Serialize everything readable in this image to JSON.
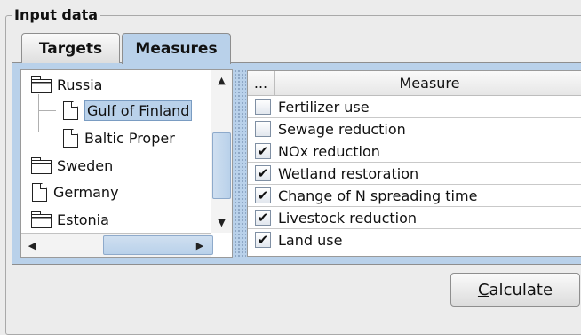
{
  "group": {
    "title": "Input data"
  },
  "tabs": [
    {
      "label": "Targets",
      "selected": false
    },
    {
      "label": "Measures",
      "selected": true
    }
  ],
  "tree": {
    "items": [
      {
        "label": "Russia",
        "icon": "folder-icon",
        "level": 0
      },
      {
        "label": "Gulf of Finland",
        "icon": "file-icon",
        "level": 1,
        "selected": true
      },
      {
        "label": "Baltic Proper",
        "icon": "file-icon",
        "level": 1
      },
      {
        "label": "Sweden",
        "icon": "folder-icon",
        "level": 0
      },
      {
        "label": "Germany",
        "icon": "file-icon",
        "level": 0
      },
      {
        "label": "Estonia",
        "icon": "folder-icon",
        "level": 0
      }
    ]
  },
  "table": {
    "columns": [
      "...",
      "Measure"
    ],
    "rows": [
      {
        "checked": false,
        "measure": "Fertilizer use"
      },
      {
        "checked": false,
        "measure": "Sewage reduction"
      },
      {
        "checked": true,
        "measure": "NOx reduction"
      },
      {
        "checked": true,
        "measure": "Wetland restoration"
      },
      {
        "checked": true,
        "measure": "Change of N spreading time"
      },
      {
        "checked": true,
        "measure": "Livestock reduction"
      },
      {
        "checked": true,
        "measure": "Land use"
      }
    ]
  },
  "button": {
    "mnemonic": "C",
    "rest": "alculate"
  },
  "colors": {
    "accent": "#b9d1ea",
    "background": "#ececec"
  }
}
